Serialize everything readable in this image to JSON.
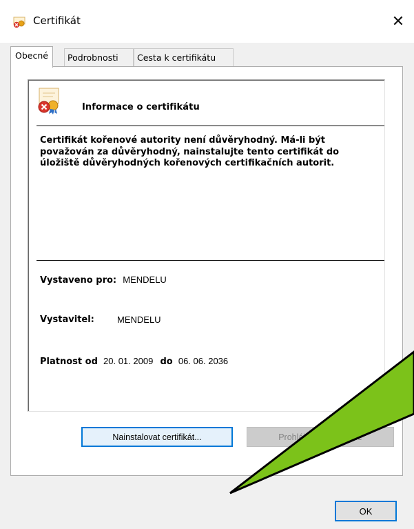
{
  "window": {
    "title": "Certifikát",
    "close_glyph": "✕"
  },
  "tabs": [
    {
      "label": "Obecné",
      "active": true
    },
    {
      "label": "Podrobnosti",
      "active": false
    },
    {
      "label": "Cesta k certifikátu",
      "active": false
    }
  ],
  "general": {
    "info_title": "Informace o certifikátu",
    "description": "Certifikát kořenové autority není důvěryhodný. Má-li být považován za důvěryhodný, nainstalujte tento certifikát do úložiště důvěryhodných kořenových certifikačních autorit.",
    "issued_to_label": "Vystaveno pro:",
    "issued_to_value": "MENDELU",
    "issuer_label": "Vystavitel:",
    "issuer_value": "MENDELU",
    "validity_from_label": "Platnost od",
    "validity_from_value": "20. 01. 2009",
    "validity_to_label": "do",
    "validity_to_value": "06. 06. 2036"
  },
  "buttons": {
    "install": "Nainstalovat certifikát...",
    "issuer_statement": "Prohlášení vystavitele",
    "ok": "OK"
  },
  "icons": {
    "window": "certificate-error-icon",
    "info": "certificate-error-icon",
    "annotation": "green-callout-arrow"
  },
  "colors": {
    "accent": "#0078d7",
    "annotation_fill": "#7cc21a",
    "error_red": "#d8352b",
    "seal_gold": "#e8a317"
  }
}
